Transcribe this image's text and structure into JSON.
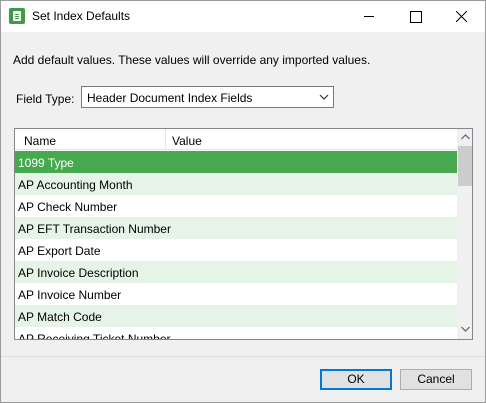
{
  "window": {
    "title": "Set Index Defaults",
    "description": "Add default values. These values will override any imported values."
  },
  "field_type": {
    "label": "Field Type:",
    "selected": "Header Document Index Fields"
  },
  "grid": {
    "columns": [
      "Name",
      "Value"
    ],
    "rows": [
      {
        "name": "1099 Type",
        "value": ""
      },
      {
        "name": "AP Accounting Month",
        "value": ""
      },
      {
        "name": "AP Check Number",
        "value": ""
      },
      {
        "name": "AP EFT Transaction Number",
        "value": ""
      },
      {
        "name": "AP Export Date",
        "value": ""
      },
      {
        "name": "AP Invoice Description",
        "value": ""
      },
      {
        "name": "AP Invoice Number",
        "value": ""
      },
      {
        "name": "AP Match Code",
        "value": ""
      },
      {
        "name": "AP Receiving Ticket Number",
        "value": ""
      }
    ],
    "selected_index": 0
  },
  "buttons": {
    "ok": "OK",
    "cancel": "Cancel"
  },
  "colors": {
    "selected_row": "#46a84f",
    "alt_row": "#e5f4e6",
    "accent": "#0078d7"
  }
}
